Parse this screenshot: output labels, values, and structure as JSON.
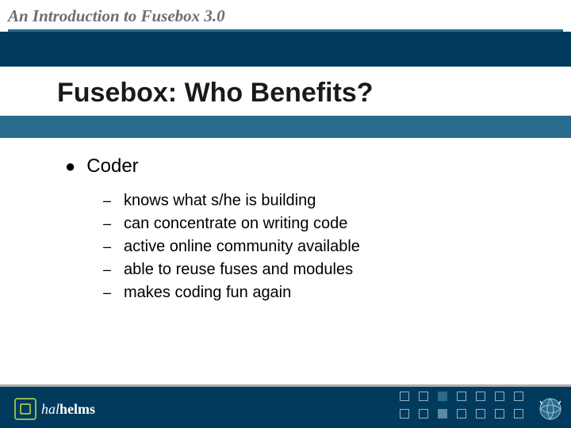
{
  "header": {
    "title": "An Introduction to Fusebox 3.0"
  },
  "slide": {
    "title": "Fusebox: Who Benefits?"
  },
  "content": {
    "main_bullet": "Coder",
    "sub_bullets": [
      "knows what s/he is building",
      "can concentrate on writing code",
      "active online community available",
      "able to reuse fuses and modules",
      "makes coding fun again"
    ]
  },
  "footer": {
    "logo_part1": "hal",
    "logo_part2": "helms"
  }
}
